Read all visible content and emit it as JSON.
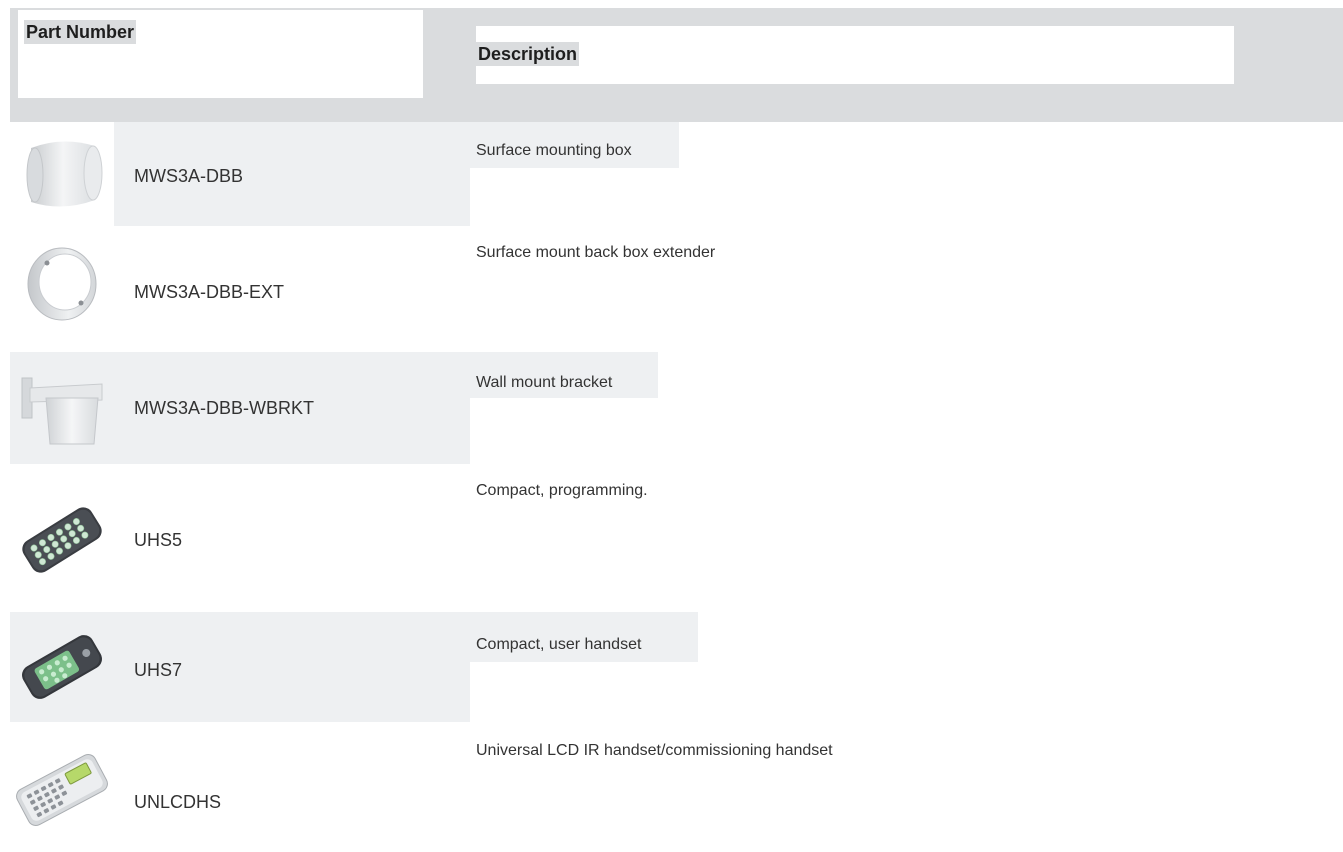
{
  "header": {
    "part_number_label": "Part Number",
    "description_label": "Description"
  },
  "rows": [
    {
      "part_number": "MWS3A-DBB",
      "description": "Surface mounting box",
      "icon": "surface-mounting-box-icon"
    },
    {
      "part_number": "MWS3A-DBB-EXT",
      "description": "Surface mount back box extender",
      "icon": "back-box-extender-icon"
    },
    {
      "part_number": "MWS3A-DBB-WBRKT",
      "description": "Wall mount bracket",
      "icon": "wall-mount-bracket-icon"
    },
    {
      "part_number": "UHS5",
      "description": "Compact, programming.",
      "icon": "programming-handset-icon"
    },
    {
      "part_number": "UHS7",
      "description": "Compact, user handset",
      "icon": "user-handset-icon"
    },
    {
      "part_number": "UNLCDHS",
      "description": "Universal LCD IR handset/commissioning handset",
      "icon": "lcd-ir-handset-icon"
    }
  ],
  "colors": {
    "header_band": "#dadcde",
    "row_highlight": "#eef0f2",
    "handset_body": "#3a3d42",
    "handset_keys_green": "#7cc08a"
  }
}
